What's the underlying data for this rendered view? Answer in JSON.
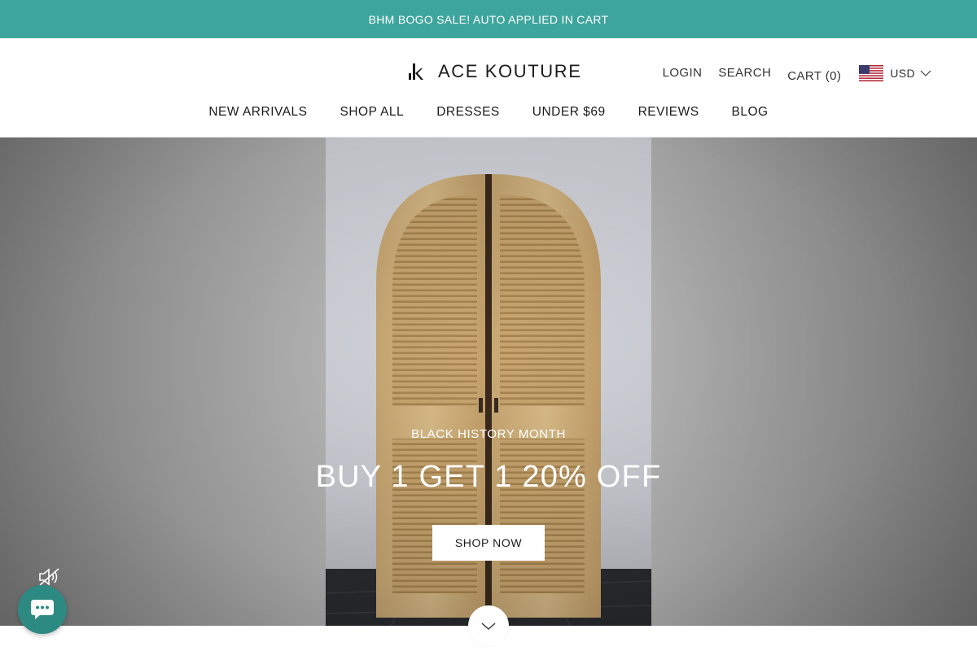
{
  "announcement": {
    "text": "BHM BOGO SALE! AUTO APPLIED IN CART"
  },
  "header": {
    "logo_text": "ACE KOUTURE",
    "actions": {
      "login": "LOGIN",
      "search": "SEARCH",
      "cart": "CART (0)"
    },
    "currency": {
      "code": "USD",
      "flag_icon": "us-flag-icon"
    }
  },
  "nav": {
    "items": [
      {
        "label": "NEW ARRIVALS"
      },
      {
        "label": "SHOP ALL"
      },
      {
        "label": "DRESSES"
      },
      {
        "label": "UNDER $69"
      },
      {
        "label": "REVIEWS"
      },
      {
        "label": "BLOG"
      }
    ]
  },
  "hero": {
    "kicker": "BLACK HISTORY MONTH",
    "title": "BUY 1 GET 1 20% OFF",
    "button": "SHOP NOW"
  },
  "icons": {
    "mute": "speaker-muted-icon",
    "scroll_down": "chevron-down-icon",
    "chat": "chat-bubble-icon"
  },
  "colors": {
    "announcement_bg": "#3ea59d",
    "chat_bg": "#2c8a83",
    "text": "#1c1b1b"
  }
}
